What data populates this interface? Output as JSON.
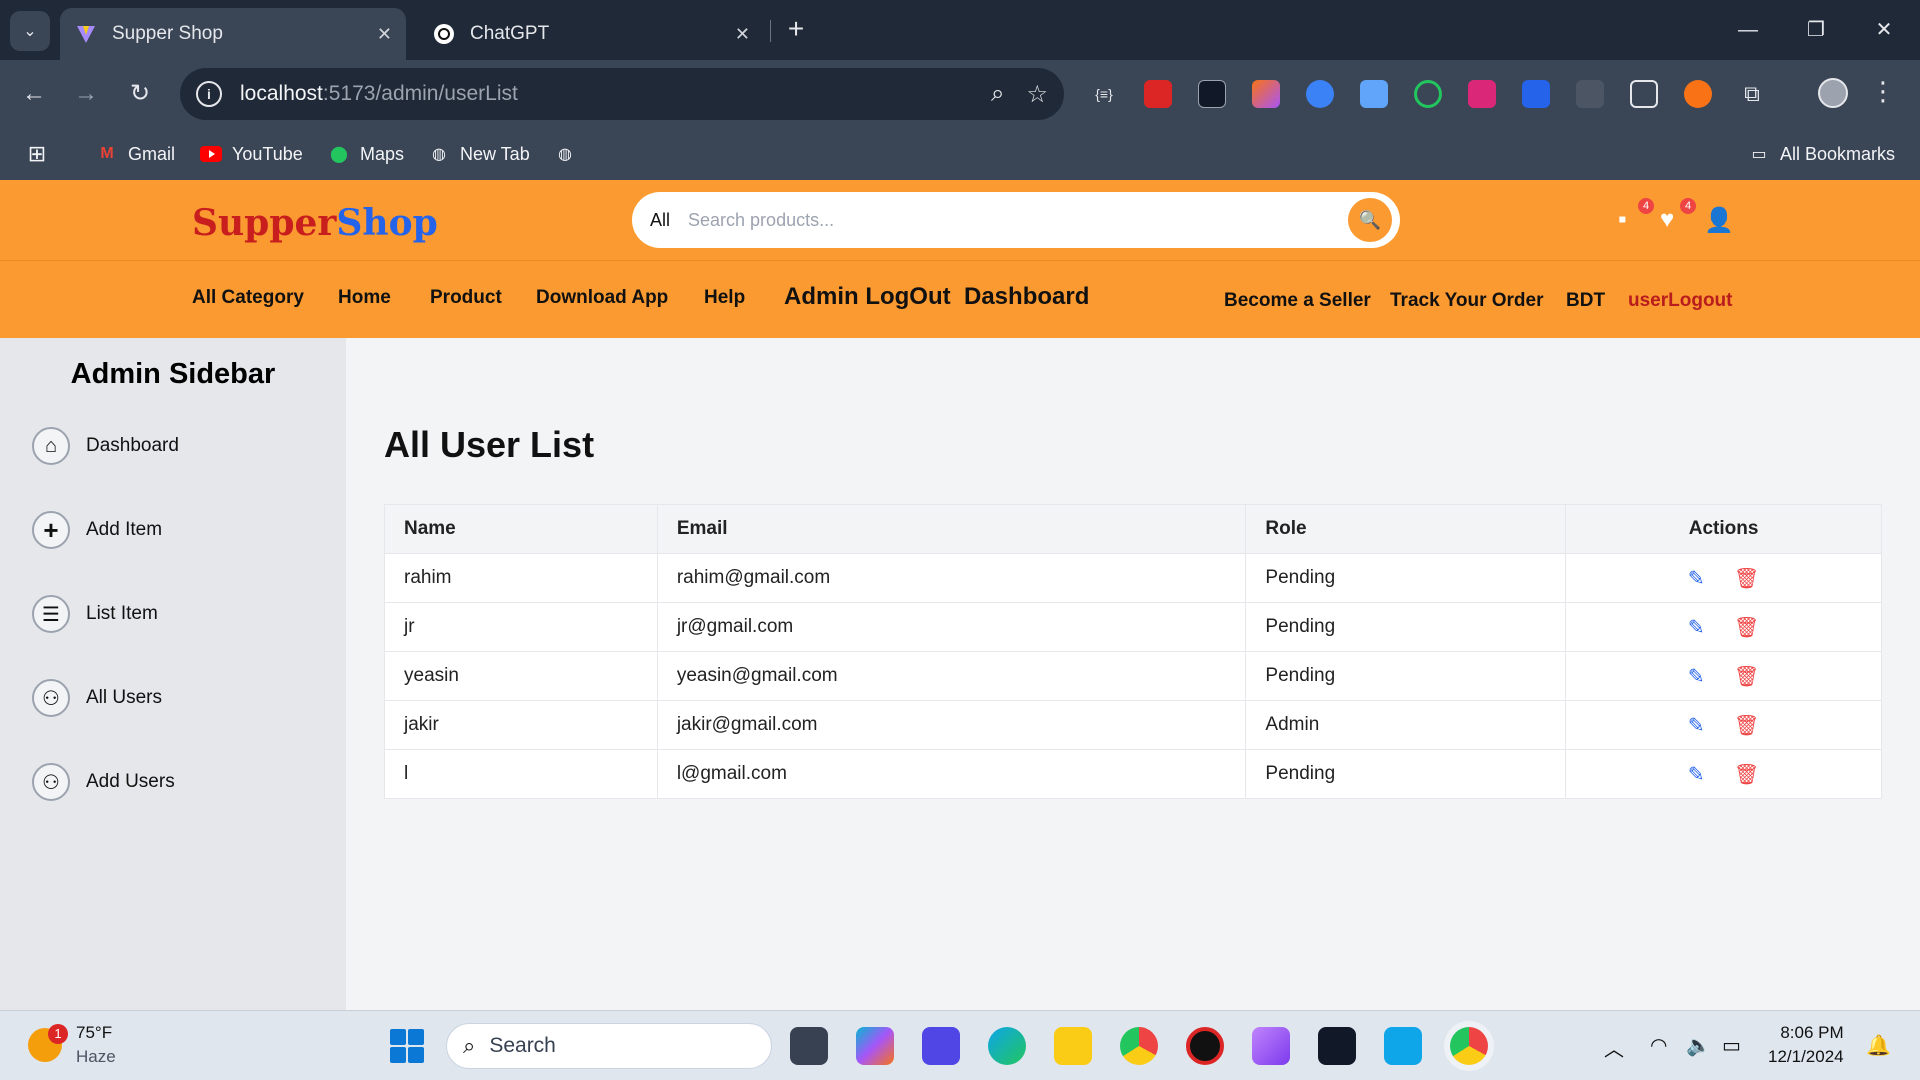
{
  "browser": {
    "tabs": [
      {
        "title": "Supper Shop",
        "active": true
      },
      {
        "title": "ChatGPT",
        "active": false
      }
    ],
    "url_host": "localhost",
    "url_path": ":5173/admin/userList",
    "bookmarks": [
      {
        "label": "Gmail",
        "icon": "gmail-icon"
      },
      {
        "label": "YouTube",
        "icon": "youtube-icon"
      },
      {
        "label": "Maps",
        "icon": "maps-icon"
      },
      {
        "label": "New Tab",
        "icon": "globe-icon"
      }
    ],
    "all_bookmarks": "All Bookmarks"
  },
  "header": {
    "logo_part1": "Supper",
    "logo_part2": "Shop",
    "search_category": "All",
    "search_placeholder": "Search products...",
    "cart_count": "4",
    "wishlist_count": "4"
  },
  "nav": {
    "all_category": "All Category",
    "home": "Home",
    "product": "Product",
    "download_app": "Download App",
    "help": "Help",
    "admin_logout": "Admin LogOut",
    "dashboard": "Dashboard",
    "become_seller": "Become a Seller",
    "track_order": "Track Your Order",
    "currency": "BDT",
    "user_logout": "userLogout"
  },
  "sidebar": {
    "title": "Admin Sidebar",
    "items": [
      {
        "label": "Dashboard",
        "icon": "home-icon"
      },
      {
        "label": "Add Item",
        "icon": "plus-circle-icon"
      },
      {
        "label": "List Item",
        "icon": "list-icon"
      },
      {
        "label": "All Users",
        "icon": "users-icon"
      },
      {
        "label": "Add Users",
        "icon": "users-icon"
      }
    ]
  },
  "main": {
    "title": "All User List",
    "columns": [
      "Name",
      "Email",
      "Role",
      "Actions"
    ],
    "rows": [
      {
        "name": "rahim",
        "email": "rahim@gmail.com",
        "role": "Pending"
      },
      {
        "name": "jr",
        "email": "jr@gmail.com",
        "role": "Pending"
      },
      {
        "name": "yeasin",
        "email": "yeasin@gmail.com",
        "role": "Pending"
      },
      {
        "name": "jakir",
        "email": "jakir@gmail.com",
        "role": "Admin"
      },
      {
        "name": "l",
        "email": "l@gmail.com",
        "role": "Pending"
      }
    ]
  },
  "taskbar": {
    "temperature": "75°F",
    "condition": "Haze",
    "weather_badge": "1",
    "search_label": "Search",
    "time": "8:06 PM",
    "date": "12/1/2024"
  },
  "colors": {
    "header_orange": "#fb9a30",
    "logo_red": "#c81e1e",
    "logo_blue": "#2563eb",
    "edit_blue": "#2563eb",
    "delete_red": "#ef4444"
  }
}
